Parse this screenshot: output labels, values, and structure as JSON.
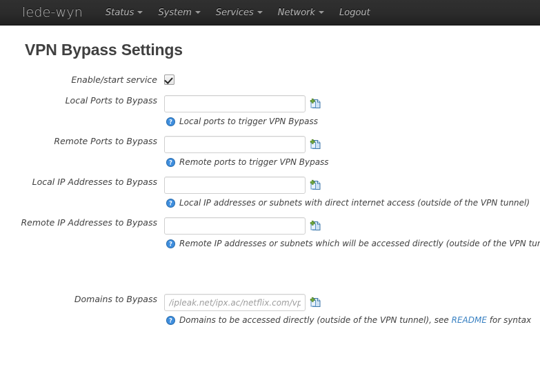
{
  "navbar": {
    "brand": "lede-wyn",
    "items": [
      {
        "label": "Status",
        "has_caret": true
      },
      {
        "label": "System",
        "has_caret": true
      },
      {
        "label": "Services",
        "has_caret": true
      },
      {
        "label": "Network",
        "has_caret": true
      },
      {
        "label": "Logout",
        "has_caret": false
      }
    ]
  },
  "page": {
    "title": "VPN Bypass Settings"
  },
  "form": {
    "enable": {
      "label": "Enable/start service",
      "checked": true
    },
    "fields": [
      {
        "label": "Local Ports to Bypass",
        "value": "",
        "placeholder": "",
        "help": "Local ports to trigger VPN Bypass",
        "help_icon": "help-circle-icon",
        "add_icon": "add-item-icon"
      },
      {
        "label": "Remote Ports to Bypass",
        "value": "",
        "placeholder": "",
        "help": "Remote ports to trigger VPN Bypass",
        "help_icon": "help-circle-icon",
        "add_icon": "add-item-icon"
      },
      {
        "label": "Local IP Addresses to Bypass",
        "value": "",
        "placeholder": "",
        "help": "Local IP addresses or subnets with direct internet access (outside of the VPN tunnel)",
        "help_icon": "help-circle-icon",
        "add_icon": "add-item-icon"
      },
      {
        "label": "Remote IP Addresses to Bypass",
        "value": "",
        "placeholder": "",
        "help": "Remote IP addresses or subnets which will be accessed directly (outside of the VPN tunnel)",
        "help_icon": "help-circle-icon",
        "add_icon": "add-item-icon"
      }
    ],
    "domains": {
      "label": "Domains to Bypass",
      "value": "",
      "placeholder": "/ipleak.net/ipx.ac/netflix.com/vpnbypass",
      "help_prefix": "Domains to be accessed directly (outside of the VPN tunnel), see ",
      "help_link": "README",
      "help_suffix": " for syntax",
      "help_icon": "help-circle-icon",
      "add_icon": "add-item-icon"
    }
  },
  "colors": {
    "navbar_bg": "#2b2b2b",
    "brand_text": "#b6b6b6",
    "link": "#3880c2",
    "help_icon": "#3e8ede",
    "add_plus": "#6fa83a",
    "text": "#404040"
  }
}
